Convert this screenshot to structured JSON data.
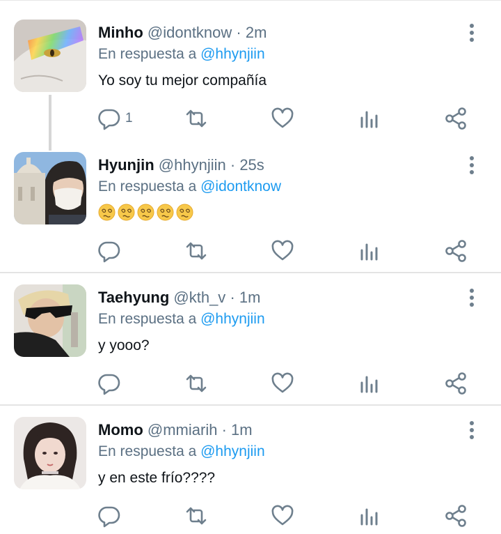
{
  "reply_prefix": "En respuesta a",
  "colors": {
    "name": "#0f1419",
    "muted": "#5b7083",
    "mention": "#1d9bf0",
    "icon": "#6e7f8d",
    "divider": "#e4e4e4"
  },
  "tweets": [
    {
      "author": "Minho",
      "handle": "@idontknow",
      "separator": "·",
      "time": "2m",
      "reply_to": "@hhynjiin",
      "text": "Yo soy tu mejor compañía",
      "reply_count": "1",
      "avatar": "white-cat-rainbow-avatar"
    },
    {
      "author": "Hyunjin",
      "handle": "@hhynjiin",
      "separator": "·",
      "time": "25s",
      "reply_to": "@idontknow",
      "emojis": [
        "woozy-face",
        "woozy-face",
        "woozy-face",
        "woozy-face",
        "woozy-face"
      ],
      "avatar": "selfie-mask-church-avatar"
    },
    {
      "author": "Taehyung",
      "handle": "@kth_v",
      "separator": "·",
      "time": "1m",
      "reply_to": "@hhynjiin",
      "text": "y yooo?",
      "avatar": "sunglasses-avatar"
    },
    {
      "author": "Momo",
      "handle": "@mmiarih",
      "separator": "·",
      "time": "1m",
      "reply_to": "@hhynjiin",
      "text": "y en este frío????",
      "avatar": "girl-dark-hair-avatar"
    }
  ],
  "icons": [
    "reply-icon",
    "retweet-icon",
    "like-icon",
    "analytics-icon",
    "share-icon",
    "more-icon"
  ]
}
